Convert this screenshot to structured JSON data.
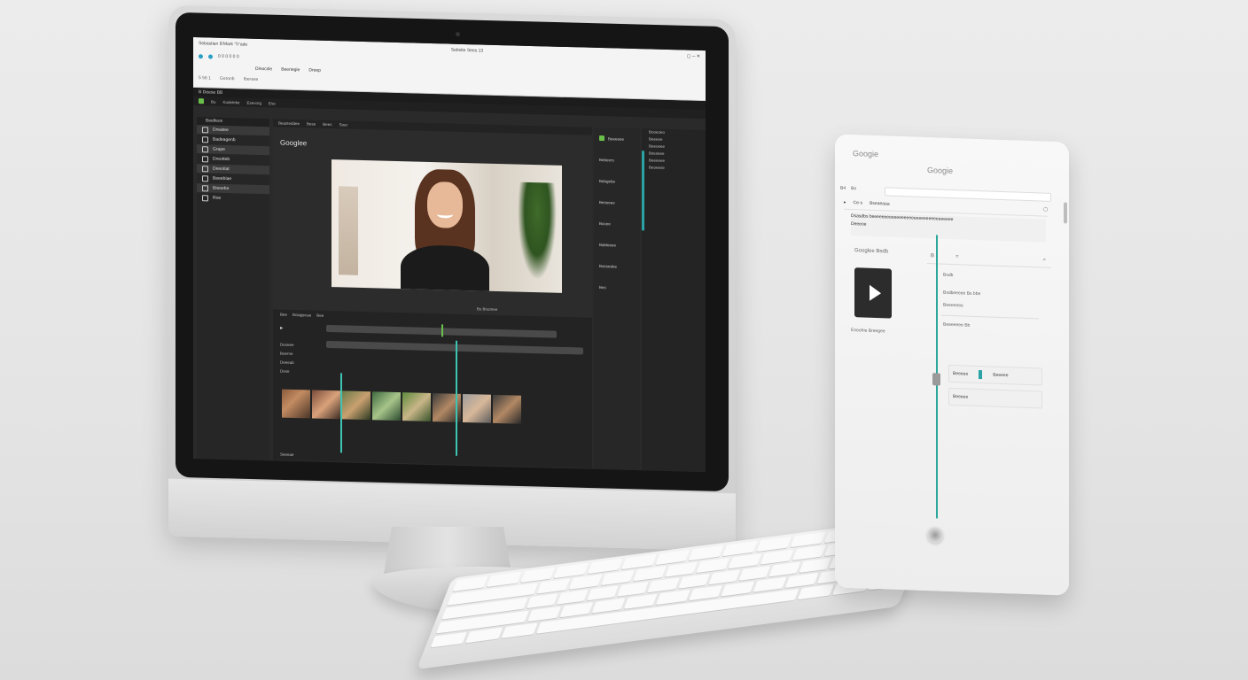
{
  "browser": {
    "tab_title": "Sebastian B'Mark 'Tr'ade",
    "window_title": "Sebsite Sees 13",
    "address": "0 0 0 0 0 0",
    "bookmarks": [
      "Dinocsle",
      "Beeriegie",
      "Dreep"
    ],
    "bookmarks2": [
      "5 56 1",
      "b",
      "Goronb",
      "ia",
      "Iberase"
    ]
  },
  "editor": {
    "app_title": "B Deese BB",
    "toolbar": [
      "Bu",
      "Kodeteke",
      "Esevorg",
      "Ese"
    ],
    "left_panel_header": "Beelleos",
    "left_items": [
      "Dreatee",
      "Badeagenb",
      "Grape",
      "Dreotteb",
      "Deeotiat",
      "Beeebiae",
      "Bieeebe",
      "Roe"
    ],
    "viewer_tabs": [
      "Beasteddee",
      "Bese",
      "Bees",
      "Soer"
    ],
    "viewer_brand": "Googlee",
    "viewer_controls": "Bs   Bnomee",
    "playback_labels": [
      "Bee",
      "Boiagecae",
      "Bee"
    ],
    "timeline_labels": [
      "Deseee",
      "Boerne",
      "Deeeab",
      "Dese",
      "Seeeae"
    ],
    "right_panel_items": [
      "Beeeeee",
      "Bebeers",
      "Bdogebe",
      "Beseeee",
      "Bocee",
      "Bdeleeee",
      "Bsesedee",
      "Bes"
    ],
    "right_panel2_items": [
      "Booeoeo",
      "Beeeee",
      "Beeoeee",
      "Bseseee",
      "Beeeeee",
      "Beoeese"
    ]
  },
  "tablet": {
    "brand_small": "Googie",
    "brand": "Googie",
    "header_items": [
      "B4",
      "Bs",
      "Bseaeaaa"
    ],
    "search_text": "Ce-s",
    "row1": "Dsasdbs beeeeeeeeeeeeeeeeeeeeeeeeeeeeeeeee",
    "row2": "Deeeoe",
    "left_title": "Googlee Bsdb",
    "caption": "Eneohie Breegee",
    "panel_left": "B",
    "panel_right": "=",
    "lines": [
      "Bsdb",
      "Bsdbeeeee    Bs bbe",
      "Beeeeeee",
      "Beeeeeee Bb"
    ],
    "box1_label": "Beeeee",
    "box1_right": "Beeeee",
    "box2_label": "Beeeee"
  },
  "colors": {
    "accent": "#2aa2a6",
    "green": "#6bc04b",
    "editor_bg": "#2a2a2a"
  }
}
